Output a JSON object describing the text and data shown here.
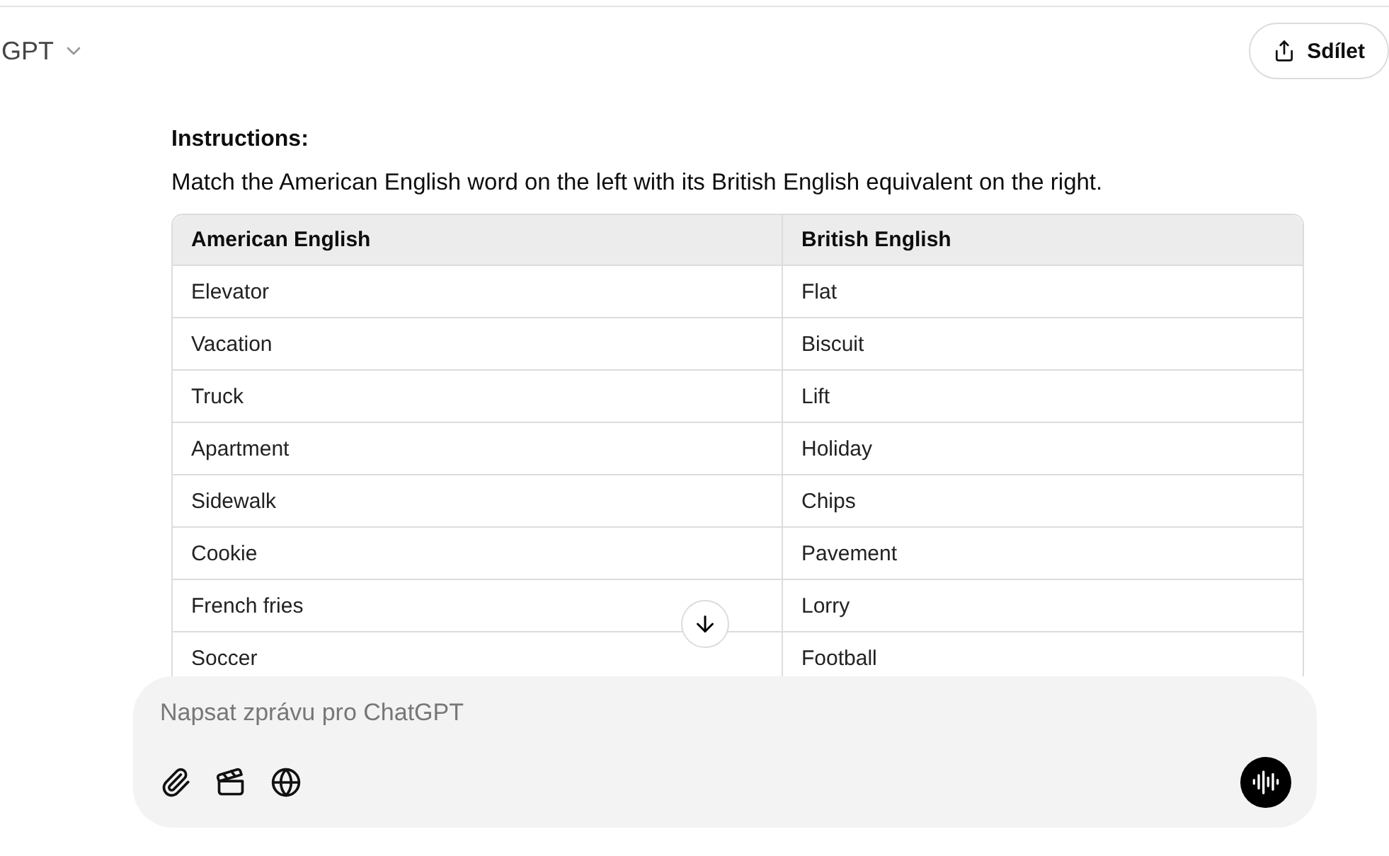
{
  "header": {
    "model_label": "GPT",
    "share_button": "Sdílet"
  },
  "instructions": {
    "heading": "Instructions:",
    "text": "Match the American English word on the left with its British English equivalent on the right."
  },
  "table": {
    "columns": [
      "American English",
      "British English"
    ],
    "rows": [
      [
        "Elevator",
        "Flat"
      ],
      [
        "Vacation",
        "Biscuit"
      ],
      [
        "Truck",
        "Lift"
      ],
      [
        "Apartment",
        "Holiday"
      ],
      [
        "Sidewalk",
        "Chips"
      ],
      [
        "Cookie",
        "Pavement"
      ],
      [
        "French fries",
        "Lorry"
      ],
      [
        "Soccer",
        "Football"
      ]
    ]
  },
  "composer": {
    "placeholder": "Napsat zprávu pro ChatGPT"
  }
}
